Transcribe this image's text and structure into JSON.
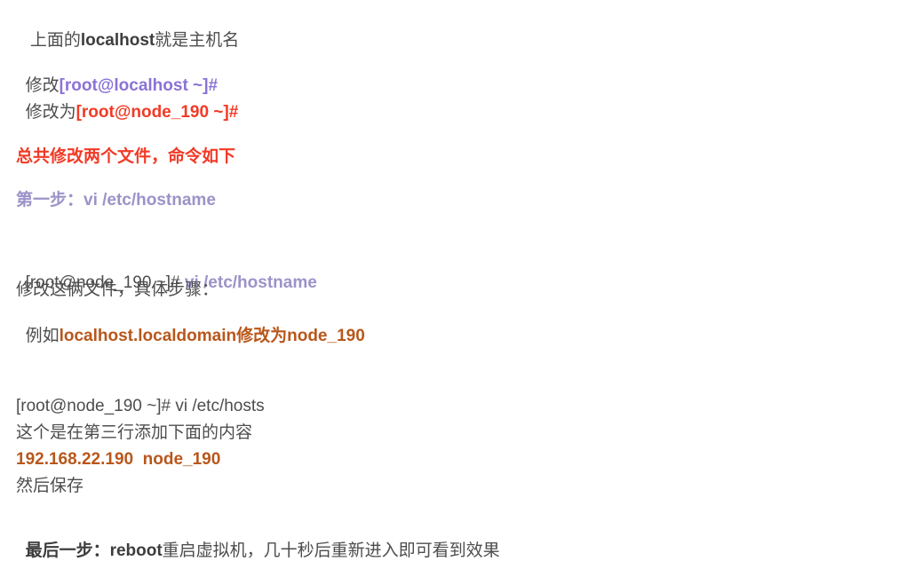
{
  "intro": {
    "prefix": " 上面的",
    "bold": "localhost",
    "suffix": "就是主机名"
  },
  "modify_from": {
    "label": "修改",
    "value": "[root@localhost ~]#"
  },
  "modify_to": {
    "label": "修改为",
    "value": "[root@node_190 ~]#"
  },
  "summary": "总共修改两个文件，命令如下",
  "step1_heading": "第一步：vi /etc/hostname",
  "cmd1": {
    "prompt": "[root@node_190 ~]# ",
    "command": "vi /etc/hostname"
  },
  "cmd1_desc": "修改这俩文件，具体步骤：",
  "cmd1_example": {
    "prefix": "例如",
    "value": "localhost.localdomain修改为node_190"
  },
  "cmd2": "[root@node_190 ~]# vi /etc/hosts",
  "cmd2_desc": "这个是在第三行添加下面的内容",
  "hosts_entry": "192.168.22.190  node_190",
  "save": "然后保存",
  "final_step": {
    "label": "最后一步：reboot",
    "text": "重启虚拟机，几十秒后重新进入即可看到效果"
  },
  "colors": {
    "body_text": "#4d4d4d",
    "purple": "#8a73d6",
    "red": "#f23a26",
    "lavender": "#9b93c8",
    "orange": "#b8571b"
  }
}
